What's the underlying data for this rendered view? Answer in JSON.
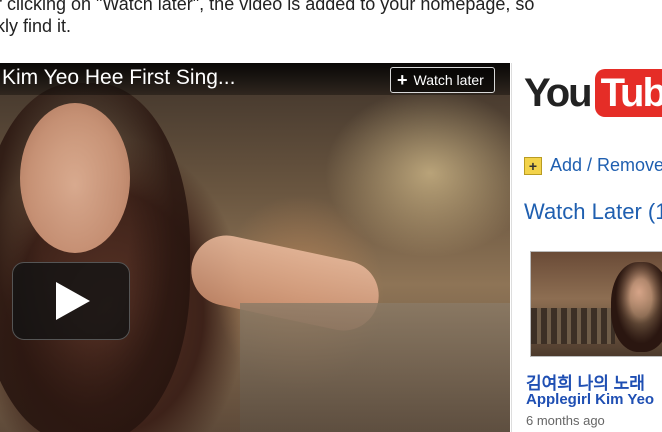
{
  "article": {
    "line1": "r clicking on \"Watch later\", the video is added to your homepage, so",
    "line2": "kly find it."
  },
  "player": {
    "title": "Kim Yeo Hee First Sing...",
    "watch_later_label": "Watch later",
    "watch_later_icon": "plus-icon",
    "play_icon": "play-icon"
  },
  "sidebar": {
    "logo_you": "You",
    "logo_tube": "Tube",
    "logo_color": "#e52d27",
    "add_remove_label": "Add / Remove",
    "add_icon_glyph": "+",
    "watch_later_heading": "Watch Later (1",
    "video": {
      "title": "김여희 나의 노래",
      "channel": "Applegirl Kim Yeo",
      "age": "6 months ago"
    }
  }
}
